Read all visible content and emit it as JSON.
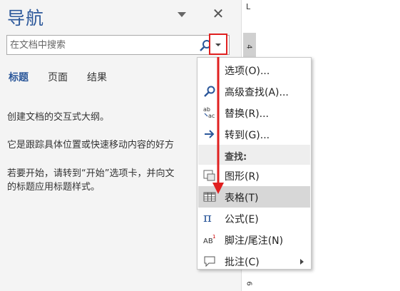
{
  "nav": {
    "title": "导航",
    "search_placeholder": "在文档中搜索",
    "tabs": [
      "标题",
      "页面",
      "结果"
    ],
    "paragraphs": [
      "创建文档的交互式大纲。",
      "它是跟踪具体位置或快速移动内容的好方",
      "若要开始，请转到“开始”选项卡，并向文",
      "的标题应用标题样式。"
    ]
  },
  "ruler": {
    "corner": "L",
    "marks": [
      "4",
      "6"
    ]
  },
  "menu": {
    "items": [
      {
        "label": "选项(O)...",
        "icon": "none"
      },
      {
        "label": "高级查找(A)...",
        "icon": "search-icon"
      },
      {
        "label": "替换(R)...",
        "icon": "replace-icon"
      },
      {
        "label": "转到(G)...",
        "icon": "arrow-right-icon"
      }
    ],
    "section_label": "查找:",
    "find_items": [
      {
        "label": "图形(R)",
        "icon": "graphic-icon"
      },
      {
        "label": "表格(T)",
        "icon": "table-icon",
        "highlighted": true
      },
      {
        "label": "公式(E)",
        "icon": "pi-icon"
      },
      {
        "label": "脚注/尾注(N)",
        "icon": "footnote-icon"
      },
      {
        "label": "批注(C)",
        "icon": "comment-icon",
        "submenu": true
      }
    ]
  },
  "colors": {
    "accent": "#2b579a",
    "annotation": "#e02020",
    "highlight": "#d7d7d7"
  }
}
